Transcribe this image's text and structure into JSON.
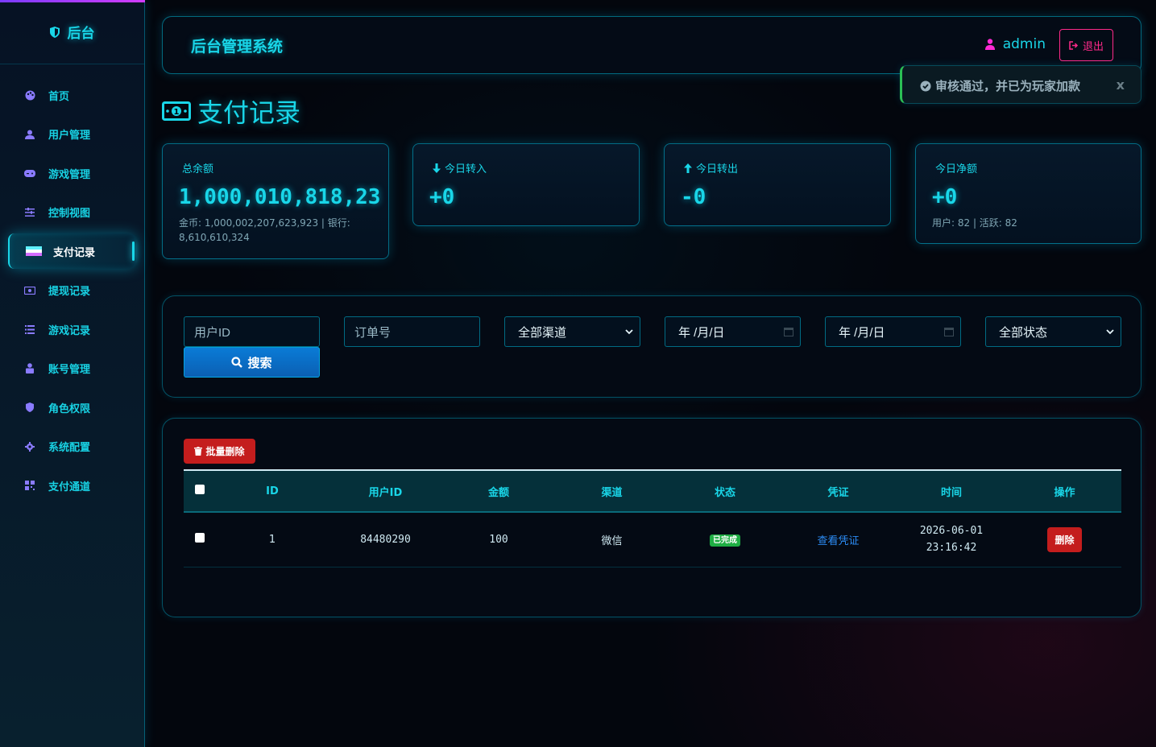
{
  "sidebar": {
    "brand": "后台",
    "items": [
      {
        "label": "首页",
        "icon": "palette-icon"
      },
      {
        "label": "用户管理",
        "icon": "users-icon"
      },
      {
        "label": "游戏管理",
        "icon": "gamepad-icon"
      },
      {
        "label": "控制视图",
        "icon": "sliders-icon"
      },
      {
        "label": "支付记录",
        "icon": "flag-icon",
        "active": true
      },
      {
        "label": "提现记录",
        "icon": "money-icon"
      },
      {
        "label": "游戏记录",
        "icon": "list-icon"
      },
      {
        "label": "账号管理",
        "icon": "user-lock-icon"
      },
      {
        "label": "角色权限",
        "icon": "shield-icon"
      },
      {
        "label": "系统配置",
        "icon": "gear-icon"
      },
      {
        "label": "支付通道",
        "icon": "qrcode-icon"
      }
    ]
  },
  "header": {
    "title": "后台管理系统",
    "username": "admin",
    "logout_label": "退出"
  },
  "toast": {
    "message": "审核通过，并已为玩家加款",
    "close": "x"
  },
  "page": {
    "title": "支付记录"
  },
  "stats": {
    "total": {
      "label": "总余额",
      "value": "1,000,010,818,23",
      "sub": "金币: 1,000,002,207,623,923 | 银行: 8,610,610,324"
    },
    "in": {
      "label": "今日转入",
      "value": "+0"
    },
    "out": {
      "label": "今日转出",
      "value": "-0"
    },
    "net": {
      "label": "今日净额",
      "value": "+0",
      "sub": "用户: 82 | 活跃: 82"
    }
  },
  "filters": {
    "user_id_placeholder": "用户ID",
    "order_placeholder": "订单号",
    "channel": "全部渠道",
    "date_start": "年 /月/日",
    "date_end": "年 /月/日",
    "status": "全部状态",
    "search_label": "搜索"
  },
  "table": {
    "bulk_delete_label": "批量删除",
    "columns": [
      "ID",
      "用户ID",
      "金额",
      "渠道",
      "状态",
      "凭证",
      "时间",
      "操作"
    ],
    "rows": [
      {
        "id": "1",
        "user_id": "84480290",
        "amount": "100",
        "channel": "微信",
        "status": "已完成",
        "voucher": "查看凭证",
        "date": "2026-06-01",
        "time": "23:16:42",
        "action": "删除"
      }
    ]
  },
  "colors": {
    "accent": "#19d6e8",
    "logout": "#ff2a8a",
    "danger": "#c41d1d",
    "success": "#1fae44",
    "link": "#2c8cf5"
  }
}
